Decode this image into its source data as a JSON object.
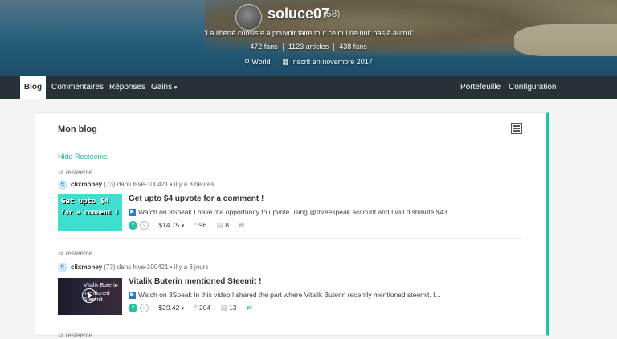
{
  "profile": {
    "username": "soluce07",
    "reputation": "(58)",
    "quote": "\"La liberté consiste à pouvoir faire tout ce qui ne nuit pas à autrui\"",
    "fans": "472 fans",
    "articles": "1123 articles",
    "followed": "438 fans",
    "location": "World",
    "joined": "Inscrit en novembre 2017",
    "location_icon": "pin-icon",
    "calendar_icon": "calendar-icon"
  },
  "nav": {
    "blog": "Blog",
    "comments": "Commentaires",
    "replies": "Réponses",
    "rewards": "Gains",
    "wallet": "Portefeuille",
    "settings": "Configuration"
  },
  "blog": {
    "title": "Mon blog",
    "hide_resteems": "Hide Resteems",
    "posts": [
      {
        "resteem": "resteemé",
        "author": "clixmoney",
        "rep": "(73)",
        "community": "dans hive-100421 • il y a 3 heures",
        "title": "Get upto $4 upvote for a comment !",
        "thumb_text1": "Get upto $4",
        "thumb_text2": "for a comment !",
        "desc": "Watch on 3Speak I have the opportunity to upvote using @threespeak account and I will distribute $43...",
        "payout": "$14.75",
        "votes": "96",
        "comments": "8"
      },
      {
        "resteem": "resteemé",
        "author": "clixmoney",
        "rep": "(73)",
        "community": "dans hive-100421 • il y a 3 jours",
        "title": "Vitalik Buterin mentioned Steemit !",
        "thumb_text1": "Vitalik Buterin",
        "thumb_text2": "mentioned Steemit",
        "desc": "Watch on 3Speak In this video I shared the part where Vitalik Buterin recently mentioned steemit. I...",
        "payout": "$29.42",
        "votes": "204",
        "comments": "13"
      },
      {
        "resteem": "resteemé"
      }
    ]
  },
  "colors": {
    "accent": "#22c3a0",
    "navbar": "#263238"
  }
}
